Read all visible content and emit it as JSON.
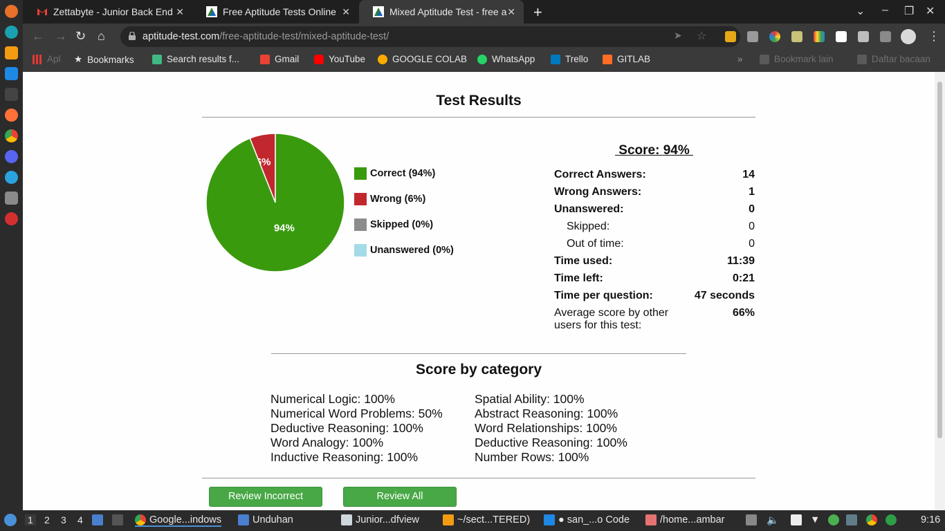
{
  "tabs": [
    {
      "title": "Zettabyte - Junior Back End",
      "icon": "gmail-icon"
    },
    {
      "title": "Free Aptitude Tests Online",
      "icon": "aptitude-logo-icon"
    },
    {
      "title": "Mixed Aptitude Test - free a",
      "icon": "aptitude-logo-icon",
      "active": true
    }
  ],
  "address": {
    "host": "aptitude-test.com",
    "path": "/free-aptitude-test/mixed-aptitude-test/"
  },
  "bookmarks": [
    {
      "label": "Apl",
      "dim": true
    },
    {
      "label": "Bookmarks"
    },
    {
      "label": "Search results f..."
    },
    {
      "label": "Gmail"
    },
    {
      "label": "YouTube"
    },
    {
      "label": "GOOGLE COLAB"
    },
    {
      "label": "WhatsApp"
    },
    {
      "label": "Trello"
    },
    {
      "label": "GITLAB"
    },
    {
      "label": "»"
    },
    {
      "label": "Bookmark lain",
      "dim": true
    },
    {
      "label": "Daftar bacaan",
      "dim": true
    }
  ],
  "page": {
    "title": "Test Results",
    "score_heading": " Score: 94% ",
    "legend": [
      {
        "label": "Correct (94%)",
        "color": "#3a9a0e"
      },
      {
        "label": "Wrong (6%)",
        "color": "#c0282d"
      },
      {
        "label": "Skipped (0%)",
        "color": "#8c8c8c"
      },
      {
        "label": "Unanswered (0%)",
        "color": "#a4dbe6"
      }
    ],
    "stats": [
      {
        "label": "Correct Answers:",
        "value": "14",
        "bold": true
      },
      {
        "label": "Wrong Answers:",
        "value": "1",
        "bold": true
      },
      {
        "label": "Unanswered:",
        "value": "0",
        "bold": true
      },
      {
        "label": "Skipped:",
        "value": "0",
        "bold": false
      },
      {
        "label": "Out of time:",
        "value": "0",
        "bold": false
      },
      {
        "label": "Time used:",
        "value": "11:39",
        "bold": true
      },
      {
        "label": "Time left:",
        "value": "0:21",
        "bold": true
      },
      {
        "label": "Time per question:",
        "value": "47 seconds",
        "bold": true
      },
      {
        "label": "Average score by other",
        "label2": "users for this test:",
        "value": "66%",
        "bold": true
      }
    ],
    "category_title": "Score by category",
    "categories_left": [
      "Numerical Logic: 100%",
      "Numerical Word Problems: 50%",
      "Deductive Reasoning: 100%",
      "Word Analogy: 100%",
      "Inductive Reasoning: 100%"
    ],
    "categories_right": [
      "Spatial Ability: 100%",
      "Abstract Reasoning: 100%",
      "Word Relationships: 100%",
      "Deductive Reasoning: 100%",
      "Number Rows: 100%"
    ],
    "buttons": {
      "review_incorrect": "Review Incorrect",
      "review_all": "Review All"
    }
  },
  "chart_data": {
    "type": "pie",
    "labels": [
      "Correct",
      "Wrong",
      "Skipped",
      "Unanswered"
    ],
    "values": [
      94,
      6,
      0,
      0
    ],
    "slice_labels": [
      "94%",
      "6%"
    ],
    "colors": [
      "#3a9a0e",
      "#c0282d",
      "#8c8c8c",
      "#a4dbe6"
    ]
  },
  "taskbar": {
    "workspaces": [
      "1",
      "2",
      "3",
      "4"
    ],
    "items": [
      "Google...indows",
      "Unduhan",
      "Junior...dfview",
      "~/sect...TERED)",
      "san_...o Code",
      "/home...ambar"
    ],
    "clock": "9:16"
  }
}
